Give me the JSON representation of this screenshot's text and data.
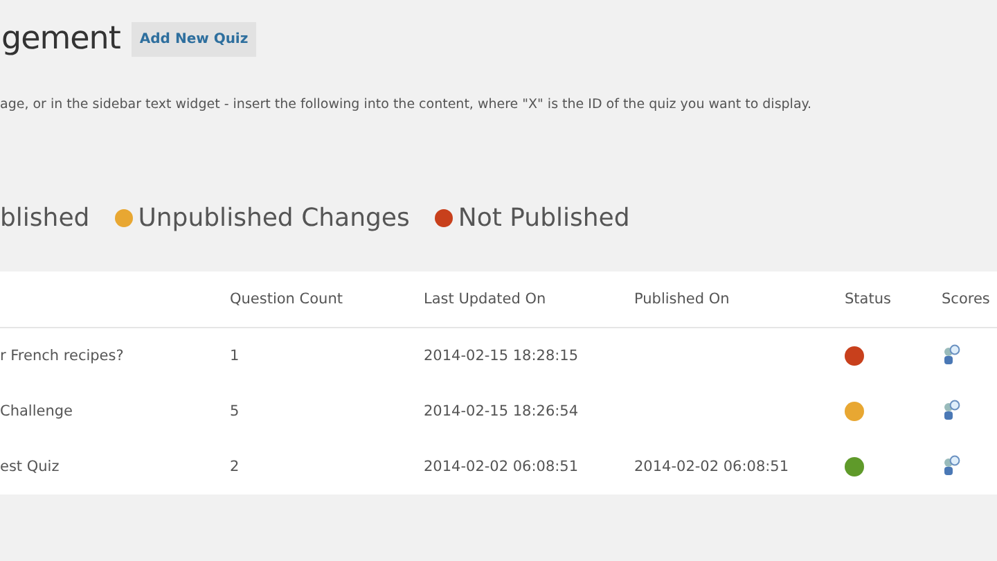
{
  "header": {
    "title": "gement",
    "add_button": "Add New Quiz"
  },
  "instructions": "age, or in the sidebar text widget - insert the following into the content, where \"X\" is the ID of the quiz you want to display.",
  "legend": [
    {
      "label": "blished"
    },
    {
      "label": "Unpublished Changes",
      "color": "#e8a732"
    },
    {
      "label": "Not Published",
      "color": "#c8401c"
    }
  ],
  "table": {
    "columns": [
      "",
      "Question Count",
      "Last Updated On",
      "Published On",
      "Status",
      "Scores"
    ],
    "rows": [
      {
        "name": "r French recipes?",
        "question_count": "1",
        "last_updated": "2014-02-15 18:28:15",
        "published_on": "",
        "color": "#c8401c"
      },
      {
        "name": "Challenge",
        "question_count": "5",
        "last_updated": "2014-02-15 18:26:54",
        "published_on": "",
        "color": "#e8a732"
      },
      {
        "name": "est Quiz",
        "question_count": "2",
        "last_updated": "2014-02-02 06:08:51",
        "published_on": "2014-02-02 06:08:51",
        "color": "#5f9a2a"
      }
    ]
  }
}
